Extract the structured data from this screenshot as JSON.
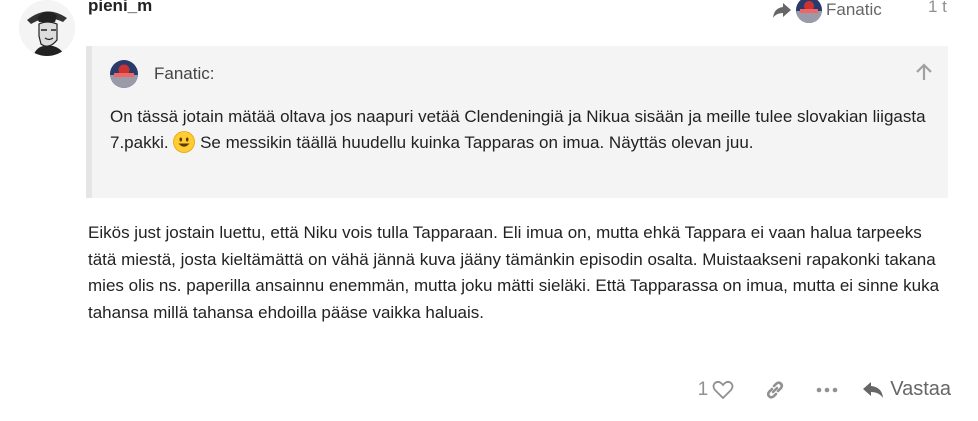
{
  "post": {
    "username": "pieni_m",
    "reply_to_name": "Fanatic",
    "date": "1 t"
  },
  "quote": {
    "author": "Fanatic:",
    "text_before": "On tässä jotain mätää oltava jos naapuri vetää Clendeningiä ja Nikua sisään ja meille tulee slovakian liigasta 7.pakki.",
    "emoji": "smiley-icon",
    "text_after": "Se messikin täällä huudellu kuinka Tapparas on imua. Näyttäs olevan juu."
  },
  "body": "Eikös just jostain luettu, että Niku vois tulla Tapparaan. Eli imua on, mutta ehkä Tappara ei vaan halua tarpeeks tätä miestä, josta kieltämättä on vähä jännä kuva jääny tämänkin episodin osalta. Muistaakseni rapakonki takana mies olis ns. paperilla ansainnu enemmän, mutta joku mätti sieläki. Että Tapparassa on imua, mutta ei sinne kuka tahansa millä tahansa ehdoilla pääse vaikka haluais.",
  "actions": {
    "like_count": "1",
    "reply_label": "Vastaa"
  },
  "colors": {
    "quote_bg": "#f4f4f4",
    "quote_border": "#e5e5e5",
    "muted": "#919191"
  }
}
